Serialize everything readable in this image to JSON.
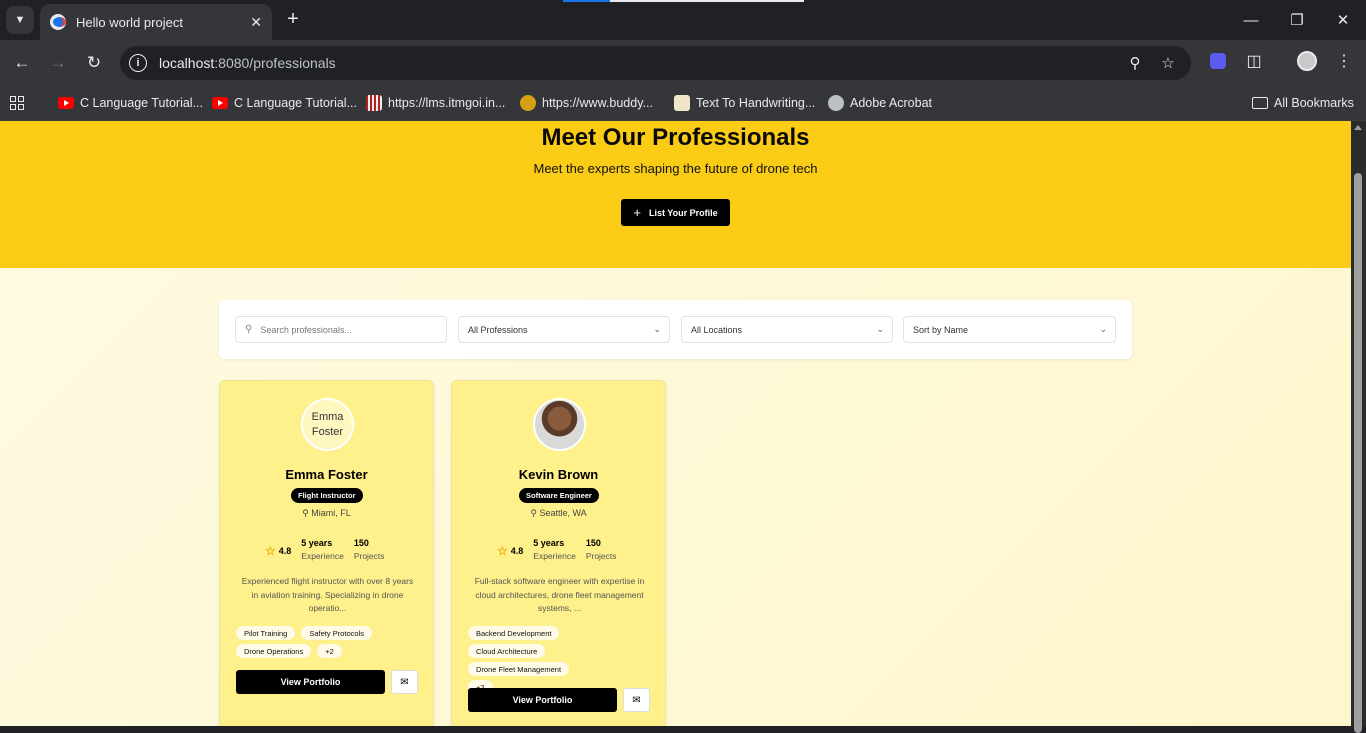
{
  "browser": {
    "tab_title": "Hello world project",
    "url_host": "localhost",
    "url_rest": ":8080/professionals",
    "bookmarks": [
      {
        "label": "C Language Tutorial...",
        "icon": "youtube-icon"
      },
      {
        "label": "C Language Tutorial...",
        "icon": "youtube-icon"
      },
      {
        "label": "https://lms.itmgoi.in...",
        "icon": "lms-icon"
      },
      {
        "label": "https://www.buddy...",
        "icon": "buddy-icon"
      },
      {
        "label": "Text To Handwriting...",
        "icon": "memo-icon"
      },
      {
        "label": "Adobe Acrobat",
        "icon": "globe-icon"
      }
    ],
    "all_bookmarks": "All Bookmarks"
  },
  "hero": {
    "title": "Meet Our Professionals",
    "subtitle": "Meet the experts shaping the future of drone tech",
    "list_button": "List Your Profile"
  },
  "filters": {
    "search_placeholder": "Search professionals...",
    "profession": "All Professions",
    "location": "All Locations",
    "sort": "Sort by Name"
  },
  "cards": [
    {
      "avatar_alt": "Emma Foster",
      "name": "Emma Foster",
      "role": "Flight Instructor",
      "location": "Miami, FL",
      "rating": "4.8",
      "experience_value": "5 years",
      "experience_label": "Experience",
      "projects_value": "150",
      "projects_label": "Projects",
      "description": "Experienced flight instructor with over 8 years in aviation training. Specializing in drone operatio...",
      "tags": [
        "Pilot Training",
        "Safety Protocols",
        "Drone Operations",
        "+2"
      ],
      "view_button": "View Portfolio"
    },
    {
      "avatar_alt": "Kevin Brown",
      "name": "Kevin Brown",
      "role": "Software Engineer",
      "location": "Seattle, WA",
      "rating": "4.8",
      "experience_value": "5 years",
      "experience_label": "Experience",
      "projects_value": "150",
      "projects_label": "Projects",
      "description": "Full-stack software engineer with expertise in cloud architectures, drone fleet management systems, ...",
      "tags": [
        "Backend Development",
        "Cloud Architecture",
        "Drone Fleet Management",
        "+2"
      ],
      "view_button": "View Portfolio"
    }
  ],
  "colors": {
    "hero_bg": "#facc15",
    "card_bg": "#fef08a",
    "accent": "#000000"
  }
}
